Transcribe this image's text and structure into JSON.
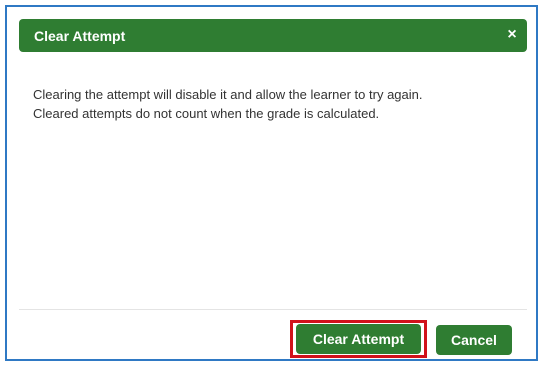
{
  "dialog": {
    "title": "Clear Attempt",
    "close_glyph": "×",
    "close_icon": "close-icon",
    "body_line_1": "Clearing the attempt will disable it and allow the learner to try again.",
    "body_line_2": "Cleared attempts do not count when the grade is calculated.",
    "primary_button_label": "Clear Attempt",
    "cancel_button_label": "Cancel"
  },
  "colors": {
    "header_green": "#2f7d32",
    "button_green": "#2f7d32",
    "highlight_red": "#d0121b",
    "frame_blue": "#2f79c4"
  }
}
